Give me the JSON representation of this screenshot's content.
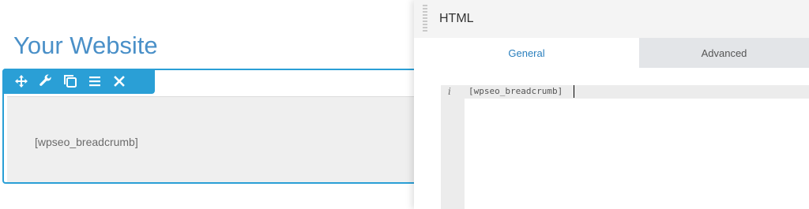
{
  "site": {
    "title": "Your Website"
  },
  "module": {
    "content": "[wpseo_breadcrumb]",
    "toolbar": [
      {
        "name": "move-icon"
      },
      {
        "name": "wrench-icon"
      },
      {
        "name": "duplicate-icon"
      },
      {
        "name": "menu-icon"
      },
      {
        "name": "close-icon"
      }
    ]
  },
  "panel": {
    "title": "HTML",
    "tabs": [
      {
        "label": "General",
        "active": true
      },
      {
        "label": "Advanced",
        "active": false
      }
    ],
    "editor": {
      "gutter_marker": "i",
      "code": "[wpseo_breadcrumb]"
    }
  },
  "colors": {
    "accent": "#2a9fd6",
    "site_title": "#4a90c8",
    "active_tab_text": "#2a7fbd"
  }
}
